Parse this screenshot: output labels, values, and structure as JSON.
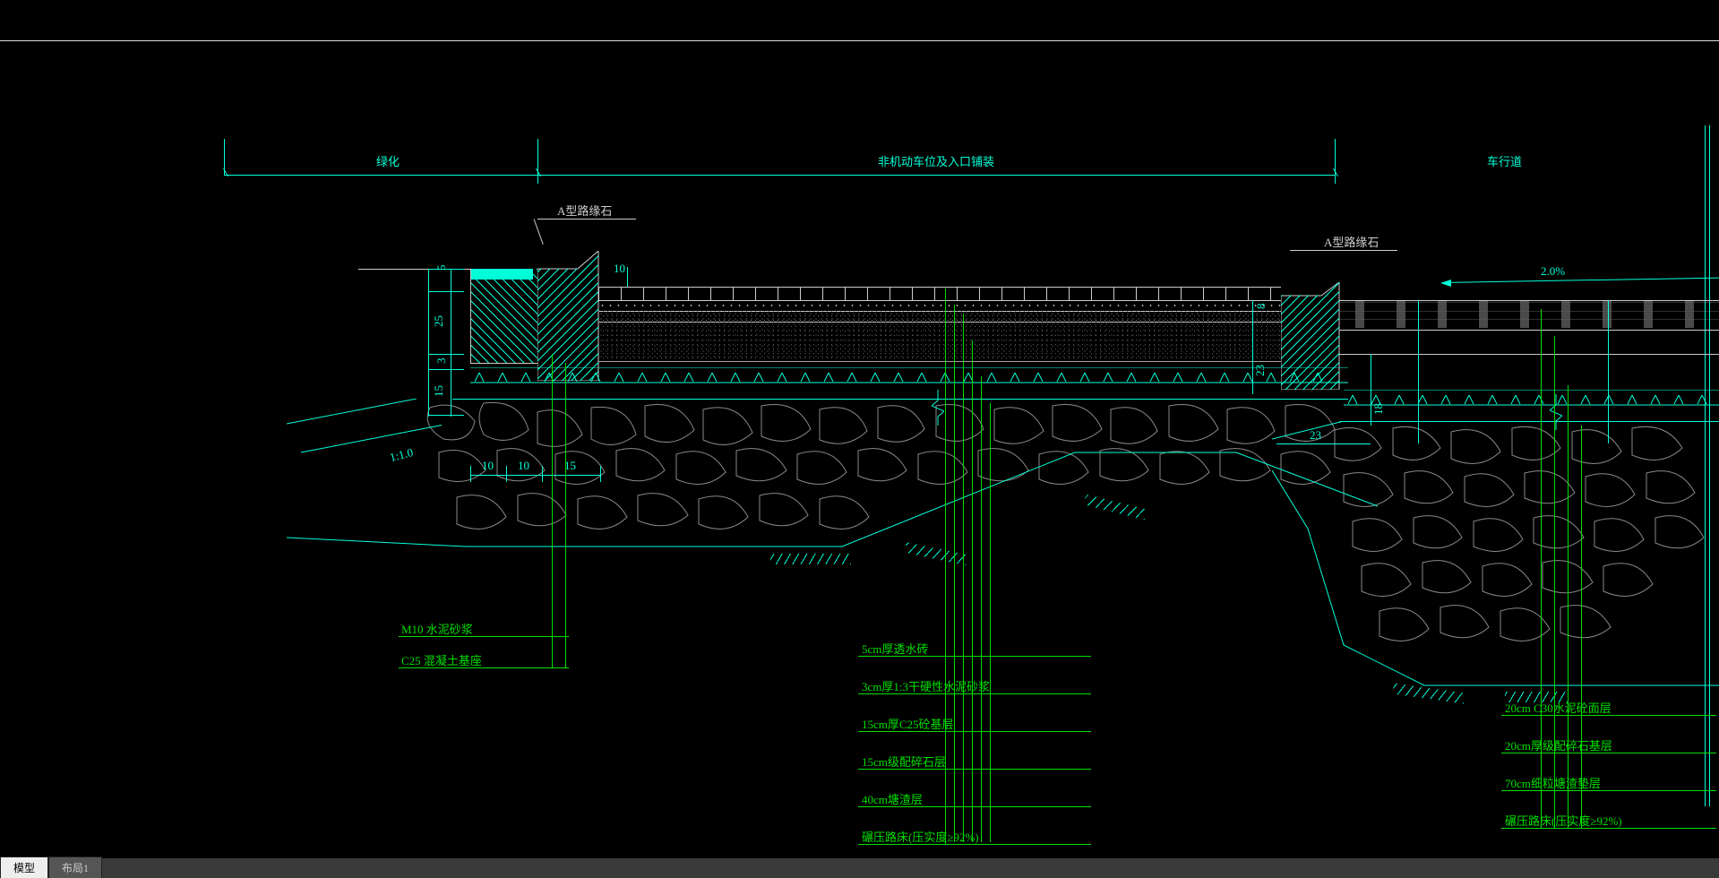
{
  "tabs": {
    "model": "模型",
    "layout1": "布局1"
  },
  "zones": {
    "greening": "绿化",
    "parking": "非机动车位及入口铺装",
    "roadway": "车行道"
  },
  "labels": {
    "curbA1": "A型路缘石",
    "curbA2": "A型路缘石",
    "slope": "2.0%",
    "slopeRatio": "1:1.0"
  },
  "dims": {
    "d5": "5",
    "d25": "25",
    "d3": "3",
    "d15": "15",
    "d10a": "10",
    "d10b": "10",
    "d15b": "15",
    "d10c": "10",
    "d8": "8",
    "d23a": "23",
    "d18": "18",
    "d23b": "23"
  },
  "notes": {
    "left": [
      "M10 水泥砂浆",
      "C25 混凝土基座"
    ],
    "middle": [
      "5cm厚透水砖",
      "3cm厚1:3干硬性水泥砂浆",
      "15cm厚C25砼基层",
      "15cm级配碎石层",
      "40cm塘渣层",
      "碾压路床(压实度≥92%)"
    ],
    "right": [
      "20cm C30水泥砼面层",
      "20cm厚级配碎石基层",
      "70cm细粒塘渣垫层",
      "碾压路床(压实度≥92%)"
    ]
  }
}
